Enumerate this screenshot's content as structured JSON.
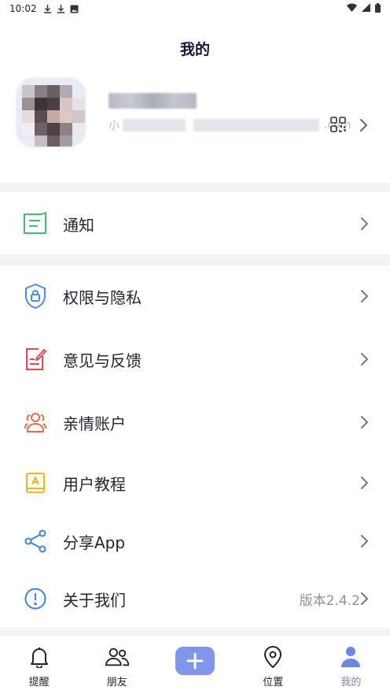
{
  "status_bar": {
    "time": "10:02",
    "icons": [
      "download-icon",
      "download-icon",
      "image-icon",
      "wifi-icon",
      "signal-icon",
      "battery-icon"
    ]
  },
  "header": {
    "title": "我的"
  },
  "profile": {
    "account_prefix": "小",
    "account_suffix": ".com"
  },
  "menu": {
    "notify": {
      "label": "通知",
      "icon": "notification-icon",
      "color": "#3fbf6f"
    },
    "privacy": {
      "label": "权限与隐私",
      "icon": "shield-lock-icon",
      "color": "#4a8ee8"
    },
    "feedback": {
      "label": "意见与反馈",
      "icon": "feedback-icon",
      "color": "#e84c4c"
    },
    "family": {
      "label": "亲情账户",
      "icon": "family-icon",
      "color": "#ef6a4a"
    },
    "tutorial": {
      "label": "用户教程",
      "icon": "book-icon",
      "color": "#f2b51d"
    },
    "share": {
      "label": "分享App",
      "icon": "share-icon",
      "color": "#3f82e0"
    },
    "about": {
      "label": "关于我们",
      "icon": "info-icon",
      "color": "#3f82e0",
      "value": "版本2.4.2"
    }
  },
  "tabs": [
    {
      "label": "提醒",
      "icon": "bell-icon"
    },
    {
      "label": "朋友",
      "icon": "friends-icon"
    },
    {
      "label": "",
      "icon": "plus-icon"
    },
    {
      "label": "位置",
      "icon": "location-pin-icon"
    },
    {
      "label": "我的",
      "icon": "user-icon",
      "active": true
    }
  ],
  "colors": {
    "accent": "#7f96ea",
    "active_tab": "#6d86e0",
    "band": "#f2f3f5"
  }
}
